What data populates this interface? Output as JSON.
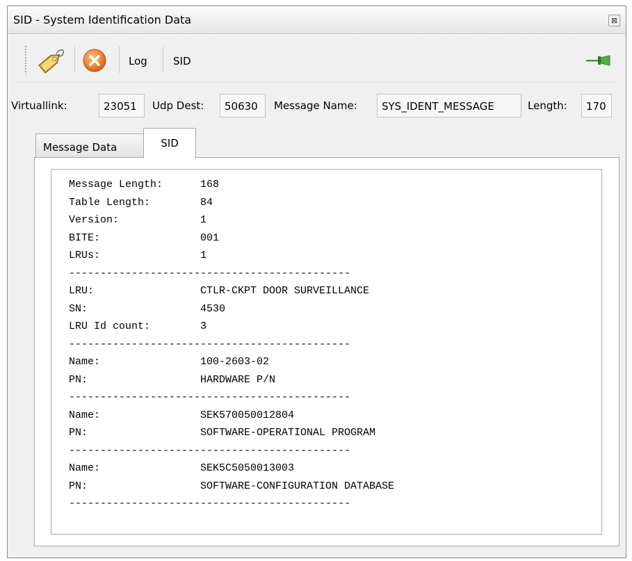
{
  "window": {
    "title": "SID - System Identification Data",
    "close_symbol": "⊠"
  },
  "toolbar": {
    "icons": [
      "tag-icon",
      "close-circle-icon",
      "pin-icon"
    ],
    "log_label": "Log",
    "sid_label": "SID"
  },
  "fields": {
    "virtuallink_label": "Virtuallink:",
    "virtuallink_value": "23051",
    "udp_dest_label": "Udp Dest:",
    "udp_dest_value": "50630",
    "message_name_label": "Message Name:",
    "message_name_value": "SYS_IDENT_MESSAGE",
    "length_label": "Length:",
    "length_value": "170"
  },
  "tabs": [
    {
      "label": "Message Data",
      "active": false
    },
    {
      "label": "SID",
      "active": true
    }
  ],
  "sid_lines": [
    {
      "key": "Message Length:",
      "value": "168"
    },
    {
      "key": "Table Length:",
      "value": "84"
    },
    {
      "key": "Version:",
      "value": "1"
    },
    {
      "key": "BITE:",
      "value": "001"
    },
    {
      "key": "LRUs:",
      "value": "1"
    },
    {
      "separator": "---------------------------------------------"
    },
    {
      "key": "LRU:",
      "value": "CTLR-CKPT DOOR SURVEILLANCE"
    },
    {
      "key": "SN:",
      "value": "4530"
    },
    {
      "key": "LRU Id count:",
      "value": "3"
    },
    {
      "separator": "---------------------------------------------"
    },
    {
      "key": "Name:",
      "value": "100-2603-02"
    },
    {
      "key": "PN:",
      "value": "HARDWARE P/N"
    },
    {
      "separator": "---------------------------------------------"
    },
    {
      "key": "Name:",
      "value": "SEK570050012804"
    },
    {
      "key": "PN:",
      "value": "SOFTWARE-OPERATIONAL PROGRAM"
    },
    {
      "separator": "---------------------------------------------"
    },
    {
      "key": "Name:",
      "value": "SEK5C5050013003"
    },
    {
      "key": "PN:",
      "value": "SOFTWARE-CONFIGURATION DATABASE"
    },
    {
      "separator": "---------------------------------------------"
    }
  ],
  "colors": {
    "tag_gold": "#e9b13b",
    "close_orange": "#ee8a3a",
    "pin_green": "#3f9a33"
  }
}
